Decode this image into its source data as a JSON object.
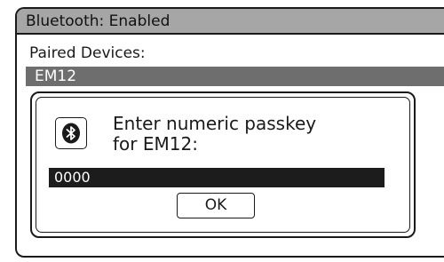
{
  "title_bar": {
    "title": "Bluetooth: Enabled"
  },
  "paired_devices": {
    "label": "Paired Devices:",
    "selected_device": "EM12"
  },
  "passkey_dialog": {
    "icon": "bluetooth-icon",
    "prompt_line1": "Enter numeric passkey",
    "prompt_line2": "for EM12:",
    "passkey_value": "0000",
    "ok_label": "OK"
  },
  "colors": {
    "title_bar_bg": "#a6a6a6",
    "selected_row_bg": "#6e6e6e",
    "passkey_field_bg": "#1c1c1c",
    "border": "#1a1a1a"
  }
}
